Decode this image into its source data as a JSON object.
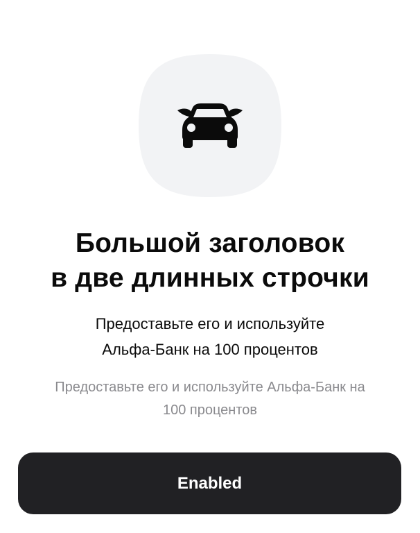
{
  "icon": {
    "name": "car-icon",
    "container_color": "#f2f3f5",
    "glyph_color": "#0b0b0b"
  },
  "title": {
    "line1": "Большой заголовок",
    "line2": "в две длинных строчки"
  },
  "subtitle": {
    "line1": "Предоставьте его и используйте",
    "line2": "Альфа-Банк на 100 процентов"
  },
  "caption": {
    "line1": "Предоставьте его и используйте Альфа-Банк на",
    "line2": "100 процентов"
  },
  "button": {
    "label": "Enabled",
    "background": "#212124",
    "text_color": "#ffffff"
  }
}
